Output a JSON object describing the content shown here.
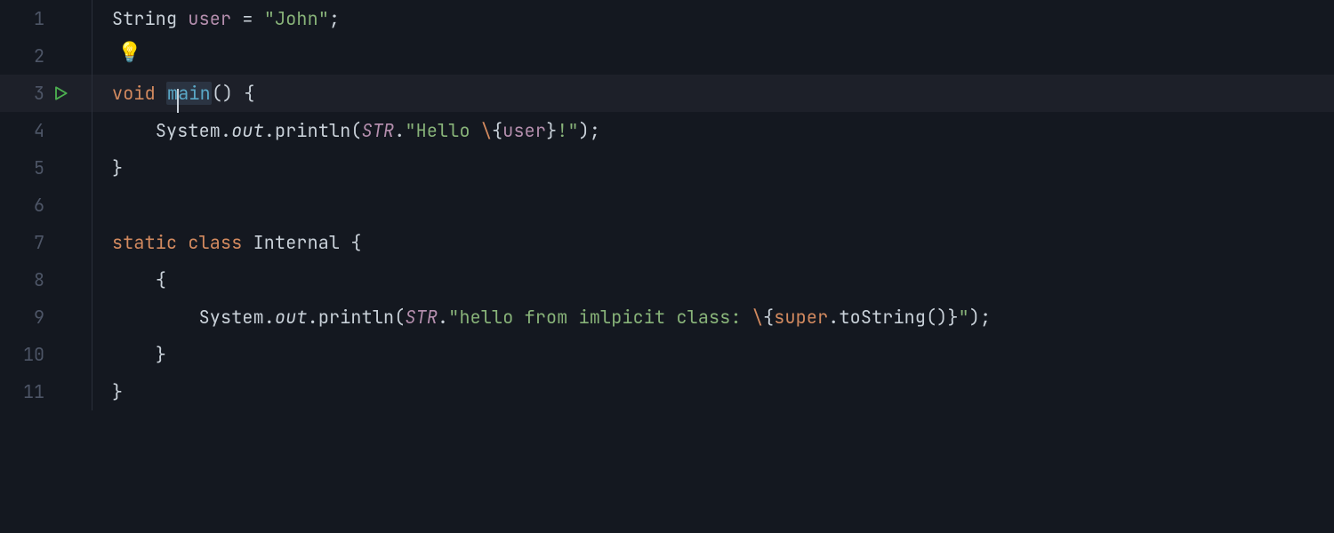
{
  "lines": {
    "1": {
      "num": "1"
    },
    "2": {
      "num": "2"
    },
    "3": {
      "num": "3"
    },
    "4": {
      "num": "4"
    },
    "5": {
      "num": "5"
    },
    "6": {
      "num": "6"
    },
    "7": {
      "num": "7"
    },
    "8": {
      "num": "8"
    },
    "9": {
      "num": "9"
    },
    "10": {
      "num": "10"
    },
    "11": {
      "num": "11"
    }
  },
  "tok": {
    "stringType": "String",
    "userVar": "user",
    "eq": " = ",
    "john": "\"John\"",
    "semi": ";",
    "voidKw": "void",
    "sp": " ",
    "main_m": "m",
    "main_ain": "ain",
    "parenBrace": "() {",
    "indent1": "    ",
    "indent2": "        ",
    "system": "System.",
    "out": "out",
    "dotPrintln": ".println(",
    "STR": "STR",
    "dot": ".",
    "helloOpen": "\"Hello ",
    "bs": "\\",
    "lb": "{",
    "user2": "user",
    "rb": "}",
    "bang": "!\"",
    "closeParen": ")",
    "closeBrace": "}",
    "staticKw": "static",
    "classKw": "class",
    "internal": "Internal",
    "openBrace": "{",
    "hello2open": "\"hello from imlpicit class: ",
    "superKw": "super",
    "toString": ".toString()",
    "quote": "\""
  },
  "icons": {
    "bulb": "💡"
  }
}
